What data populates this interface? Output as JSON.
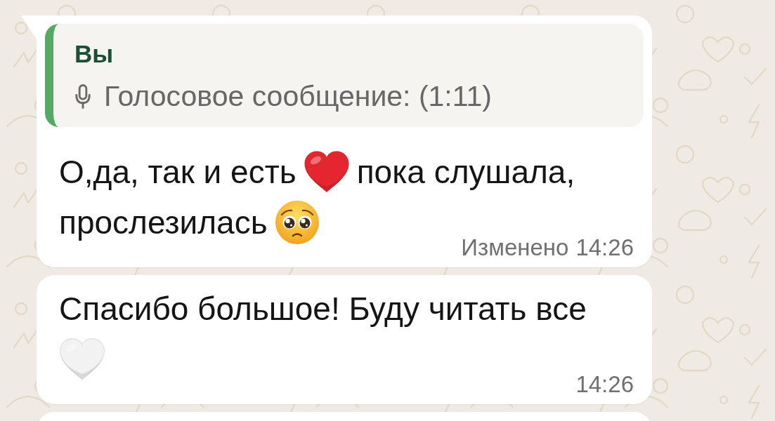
{
  "messages": [
    {
      "tail": true,
      "quote": {
        "author": "Вы",
        "preview": "Голосовое сообщение: (1:11)"
      },
      "lines": [
        [
          {
            "kind": "text",
            "text": "О,да, так и есть"
          },
          {
            "kind": "heart",
            "color": "#e3262f"
          },
          {
            "kind": "text",
            "text": "пока слушала,"
          }
        ],
        [
          {
            "kind": "text",
            "text": "прослезилась"
          },
          {
            "kind": "face"
          }
        ]
      ],
      "edited_label": "Изменено",
      "time": "14:26"
    },
    {
      "tail": false,
      "lines": [
        [
          {
            "kind": "text",
            "text": "Спасибо большое! Буду читать все"
          }
        ],
        [
          {
            "kind": "heart",
            "color": "#f2f2f2"
          }
        ]
      ],
      "time": "14:26"
    },
    {
      "tail": false
    }
  ]
}
